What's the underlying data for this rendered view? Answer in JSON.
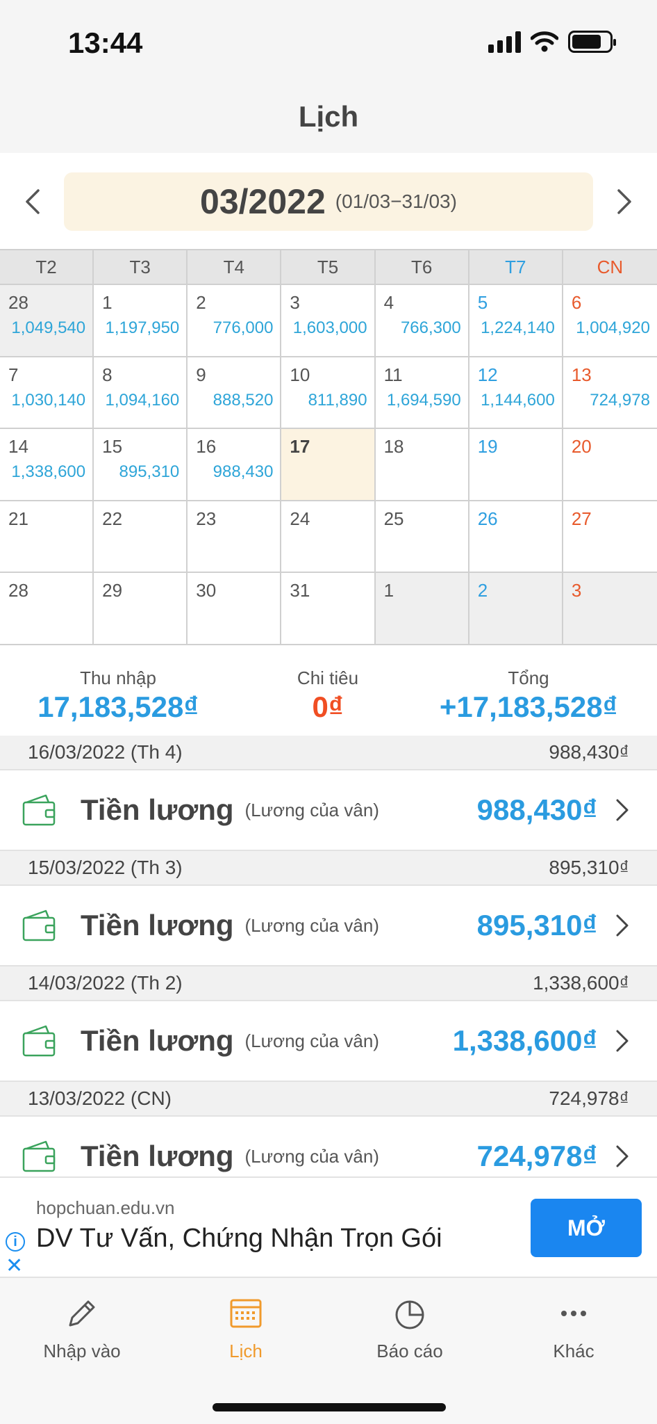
{
  "status": {
    "time": "13:44"
  },
  "nav": {
    "title": "Lịch"
  },
  "month": {
    "label": "03/2022",
    "range": "(01/03−31/03)"
  },
  "colors": {
    "accent": "#2a9be0",
    "expense": "#f04e23",
    "saturday": "#2f9fe0",
    "sunday": "#e85a2c",
    "tab_active": "#f09a2c",
    "today_bg": "#fcf3e1"
  },
  "calendar": {
    "weekdays": [
      "T2",
      "T3",
      "T4",
      "T5",
      "T6",
      "T7",
      "CN"
    ],
    "weeks": [
      [
        {
          "day": "28",
          "amount": "1,049,540",
          "other": true
        },
        {
          "day": "1",
          "amount": "1,197,950"
        },
        {
          "day": "2",
          "amount": "776,000"
        },
        {
          "day": "3",
          "amount": "1,603,000"
        },
        {
          "day": "4",
          "amount": "766,300"
        },
        {
          "day": "5",
          "amount": "1,224,140"
        },
        {
          "day": "6",
          "amount": "1,004,920"
        }
      ],
      [
        {
          "day": "7",
          "amount": "1,030,140"
        },
        {
          "day": "8",
          "amount": "1,094,160"
        },
        {
          "day": "9",
          "amount": "888,520"
        },
        {
          "day": "10",
          "amount": "811,890"
        },
        {
          "day": "11",
          "amount": "1,694,590"
        },
        {
          "day": "12",
          "amount": "1,144,600"
        },
        {
          "day": "13",
          "amount": "724,978"
        }
      ],
      [
        {
          "day": "14",
          "amount": "1,338,600"
        },
        {
          "day": "15",
          "amount": "895,310"
        },
        {
          "day": "16",
          "amount": "988,430"
        },
        {
          "day": "17",
          "amount": "",
          "today": true
        },
        {
          "day": "18",
          "amount": ""
        },
        {
          "day": "19",
          "amount": ""
        },
        {
          "day": "20",
          "amount": ""
        }
      ],
      [
        {
          "day": "21",
          "amount": ""
        },
        {
          "day": "22",
          "amount": ""
        },
        {
          "day": "23",
          "amount": ""
        },
        {
          "day": "24",
          "amount": ""
        },
        {
          "day": "25",
          "amount": ""
        },
        {
          "day": "26",
          "amount": ""
        },
        {
          "day": "27",
          "amount": ""
        }
      ],
      [
        {
          "day": "28",
          "amount": ""
        },
        {
          "day": "29",
          "amount": ""
        },
        {
          "day": "30",
          "amount": ""
        },
        {
          "day": "31",
          "amount": ""
        },
        {
          "day": "1",
          "amount": "",
          "other": true
        },
        {
          "day": "2",
          "amount": "",
          "other": true
        },
        {
          "day": "3",
          "amount": "",
          "other": true
        }
      ]
    ]
  },
  "summary": {
    "income_label": "Thu nhập",
    "income_value": "17,183,528₫",
    "expense_label": "Chi tiêu",
    "expense_value": "0₫",
    "total_label": "Tổng",
    "total_value": "+17,183,528₫"
  },
  "transactions": [
    {
      "date": "16/03/2022 (Th 4)",
      "day_total": "988,430₫",
      "icon": "wallet-icon",
      "category": "Tiền lương",
      "note": "(Lương của vân)",
      "amount": "988,430₫"
    },
    {
      "date": "15/03/2022 (Th 3)",
      "day_total": "895,310₫",
      "icon": "wallet-icon",
      "category": "Tiền lương",
      "note": "(Lương của vân)",
      "amount": "895,310₫"
    },
    {
      "date": "14/03/2022 (Th 2)",
      "day_total": "1,338,600₫",
      "icon": "wallet-icon",
      "category": "Tiền lương",
      "note": "(Lương của vân)",
      "amount": "1,338,600₫"
    },
    {
      "date": "13/03/2022 (CN)",
      "day_total": "724,978₫",
      "icon": "wallet-icon",
      "category": "Tiền lương",
      "note": "(Lương của vân)",
      "amount": "724,978₫"
    }
  ],
  "ad": {
    "domain": "hopchuan.edu.vn",
    "title": "DV Tư Vấn, Chứng Nhận Trọn Gói",
    "button": "MỞ",
    "info_glyph": "i",
    "close_glyph": "✕"
  },
  "tabs": [
    {
      "label": "Nhập vào",
      "icon": "pencil-icon",
      "active": false
    },
    {
      "label": "Lịch",
      "icon": "calendar-icon",
      "active": true
    },
    {
      "label": "Báo cáo",
      "icon": "pie-chart-icon",
      "active": false
    },
    {
      "label": "Khác",
      "icon": "more-icon",
      "active": false
    }
  ]
}
